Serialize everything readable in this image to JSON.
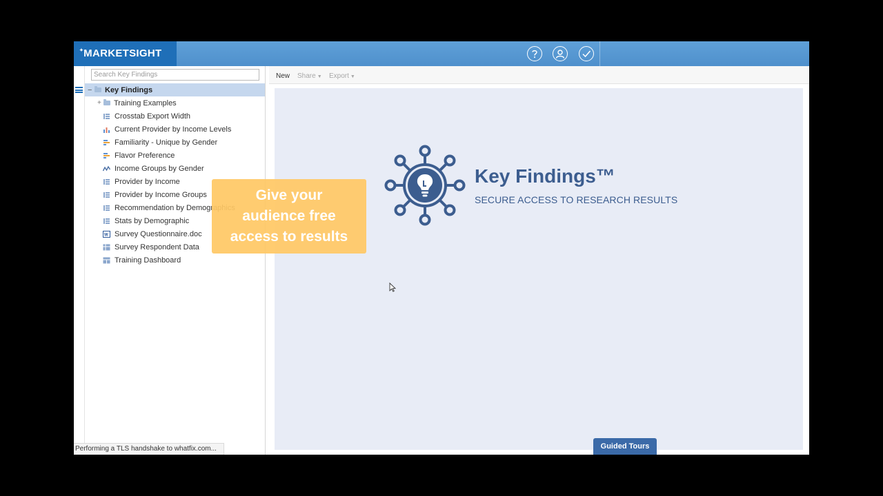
{
  "header": {
    "logo_text": "MARKETSIGHT",
    "icons": [
      "help-icon",
      "user-icon",
      "check-icon"
    ]
  },
  "sidebar": {
    "search_placeholder": "Search Key Findings",
    "root_label": "Key Findings",
    "items": [
      {
        "label": "Training Examples",
        "icon": "folder-icon"
      },
      {
        "label": "Crosstab Export Width",
        "icon": "table-icon"
      },
      {
        "label": "Current Provider by Income Levels",
        "icon": "bar-chart-icon"
      },
      {
        "label": "Familiarity - Unique by Gender",
        "icon": "bar-h-icon"
      },
      {
        "label": "Flavor Preference",
        "icon": "bar-h-icon"
      },
      {
        "label": "Income Groups by Gender",
        "icon": "line-chart-icon"
      },
      {
        "label": "Provider by Income",
        "icon": "table-icon"
      },
      {
        "label": "Provider by Income Groups",
        "icon": "table-icon"
      },
      {
        "label": "Recommendation by Demographics",
        "icon": "table-icon"
      },
      {
        "label": "Stats by Demographic",
        "icon": "table-icon"
      },
      {
        "label": "Survey Questionnaire.doc",
        "icon": "word-doc-icon"
      },
      {
        "label": "Survey Respondent Data",
        "icon": "grid-icon"
      },
      {
        "label": "Training Dashboard",
        "icon": "dashboard-icon"
      }
    ]
  },
  "status_text": "Performing a TLS handshake to whatfix.com...",
  "toolbar": {
    "new_label": "New",
    "share_label": "Share",
    "export_label": "Export"
  },
  "main": {
    "title": "Key Findings™",
    "subtitle": "SECURE ACCESS TO RESEARCH RESULTS"
  },
  "callout": {
    "lines": [
      "Give your",
      "audience free",
      "access to results"
    ]
  },
  "guided_tours_label": "Guided Tours",
  "colors": {
    "header": "#5b9bd5",
    "logo_bg": "#1f6fb8",
    "accent": "#3c5d8f",
    "selected_row": "#c5d7ee",
    "canvas": "#e8ecf6",
    "callout": "#ffc864"
  }
}
